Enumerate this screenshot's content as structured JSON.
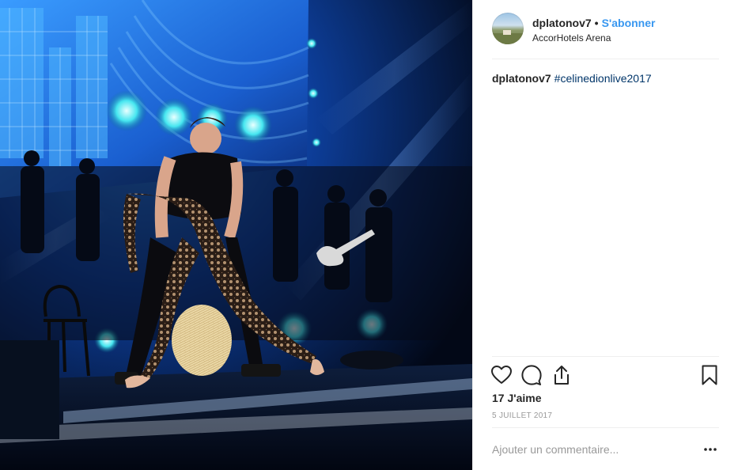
{
  "header": {
    "username": "dplatonov7",
    "separator": "•",
    "follow_label": "S'abonner",
    "location": "AccorHotels Arena"
  },
  "caption": {
    "username": "dplatonov7",
    "hashtag": "#celinedionlive2017"
  },
  "actions": {
    "icons": [
      "heart-icon",
      "comment-icon",
      "share-icon",
      "bookmark-icon"
    ]
  },
  "likes": "17 J'aime",
  "date": "5 JUILLET 2017",
  "comment": {
    "placeholder": "Ajouter un commentaire...",
    "more_label": "..."
  },
  "colors": {
    "link_blue": "#3897f0",
    "hashtag_blue": "#003569",
    "text": "#262626",
    "muted": "#999999",
    "stage_blue": "#1f6fd6"
  }
}
